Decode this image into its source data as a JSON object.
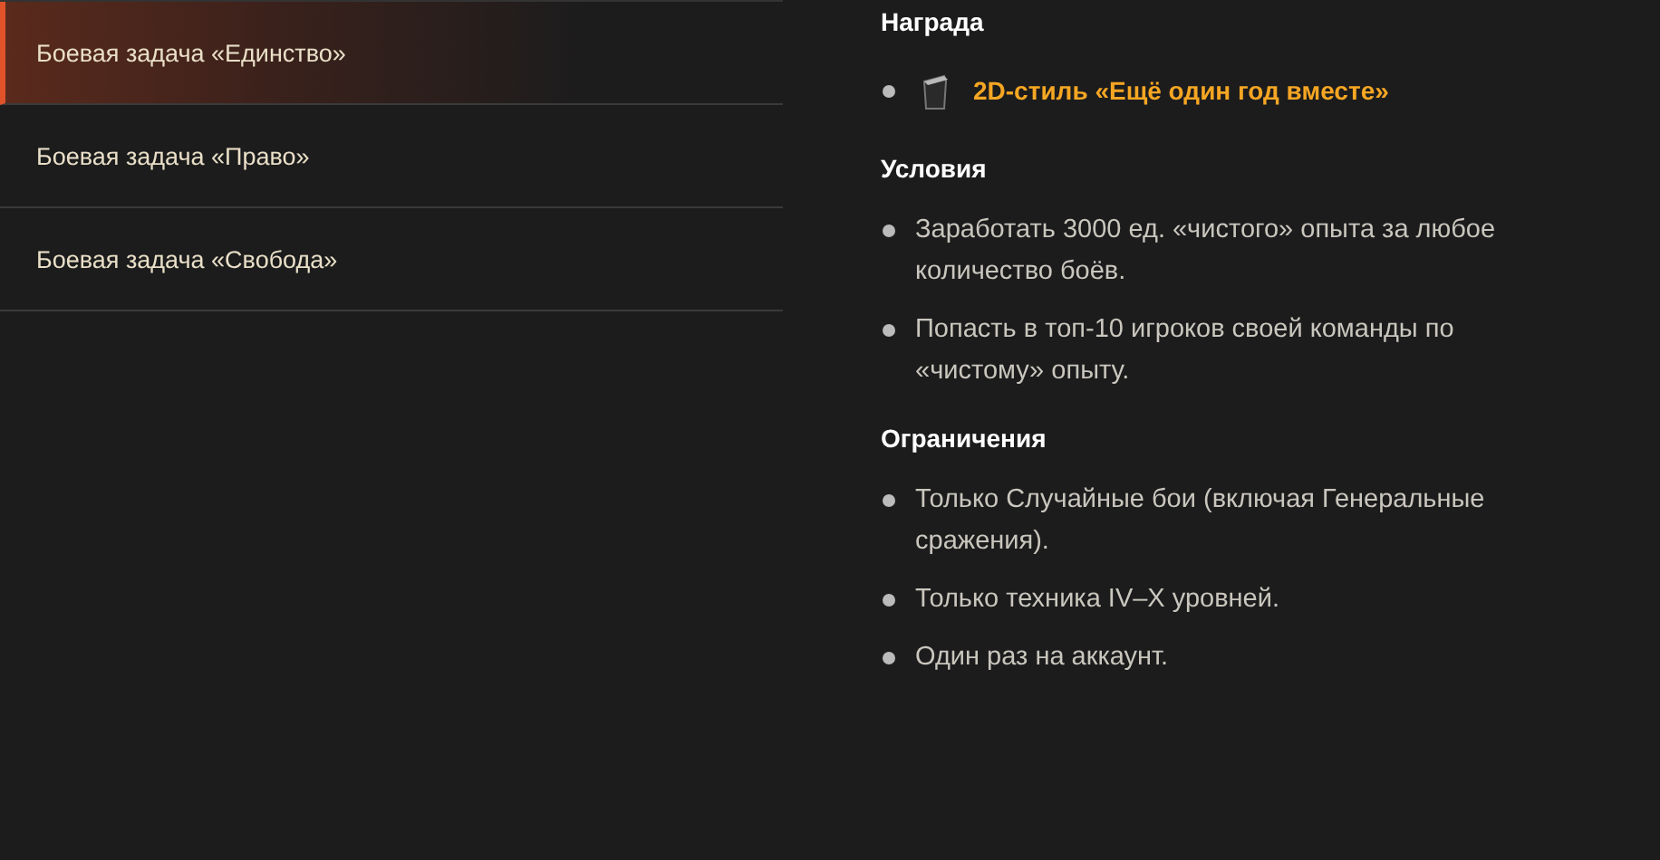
{
  "sidebar": {
    "items": [
      {
        "label": "Боевая задача «Единство»",
        "selected": true
      },
      {
        "label": "Боевая задача «Право»",
        "selected": false
      },
      {
        "label": "Боевая задача «Свобода»",
        "selected": false
      }
    ]
  },
  "sections": [
    {
      "kind": "reward",
      "heading": "Награда",
      "items": [
        "2D-стиль «Ещё один год вместе»"
      ]
    },
    {
      "kind": "list",
      "heading": "Условия",
      "items": [
        "Заработать 3000 ед. «чистого» опыта за любое количество боёв.",
        "Попасть в топ-10 игроков своей команды по «чистому» опыту."
      ]
    },
    {
      "kind": "list",
      "heading": "Ограничения",
      "items": [
        "Только Случайные бои (включая Генеральные сражения).",
        "Только техника IV–X уровней.",
        "Один раз на аккаунт."
      ]
    }
  ]
}
